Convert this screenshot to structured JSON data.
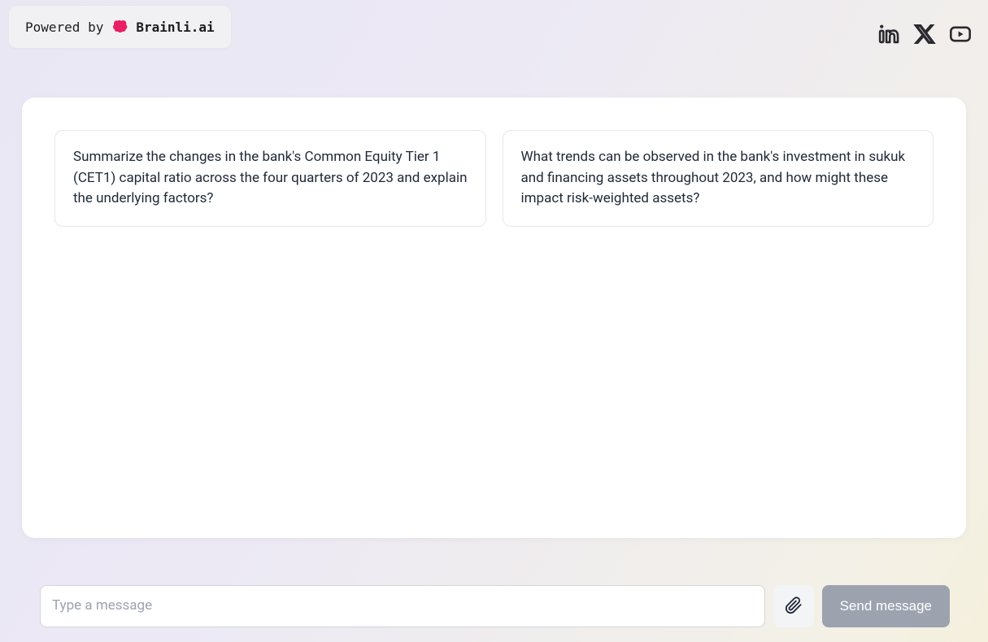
{
  "header": {
    "powered_by_label": "Powered by",
    "brand_name": "Brainli.ai"
  },
  "suggestions": {
    "card1": "Summarize the changes in the bank's Common Equity Tier 1 (CET1) capital ratio across the four quarters of 2023 and explain the underlying factors?",
    "card2": "What trends can be observed in the bank's investment in sukuk and financing assets throughout 2023, and how might these impact risk-weighted assets?"
  },
  "composer": {
    "placeholder": "Type a message",
    "send_label": "Send message"
  }
}
